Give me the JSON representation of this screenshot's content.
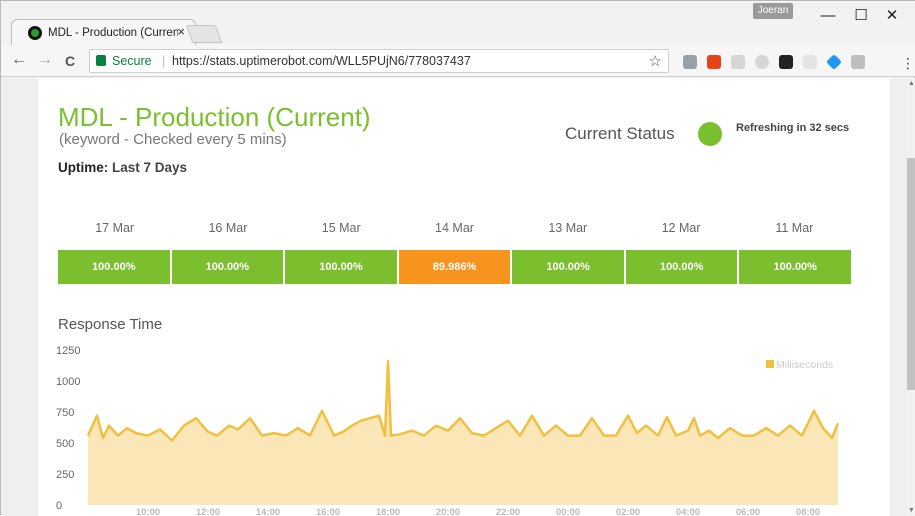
{
  "browser": {
    "tab_title": "MDL - Production (Current)",
    "tab_close": "×",
    "user_badge": "Joeran",
    "window_controls": {
      "minimize": "—",
      "maximize": "☐",
      "close": "✕"
    },
    "nav": {
      "back": "←",
      "forward": "→",
      "reload": "C"
    },
    "secure_label": "Secure",
    "url": "https://stats.uptimerobot.com/WLL5PUjN6/778037437",
    "star": "☆",
    "menu": "⋮",
    "extension_icons": [
      "download-icon",
      "office-icon",
      "cl-icon",
      "circle-icon",
      "hat-icon",
      "font-icon",
      "diamond-icon",
      "puzzle-icon"
    ]
  },
  "monitor": {
    "title": "MDL - Production (Current)",
    "subtitle": "(keyword - Checked every 5 mins)",
    "uptime_label": "Uptime",
    "uptime_range": ": Last 7 Days",
    "status_label": "Current Status",
    "status_color": "#7bbf2f",
    "refresh_text": "Refreshing in 32 secs"
  },
  "days": [
    {
      "label": "17 Mar",
      "uptime": "100.00%",
      "color": "#7bbf2f"
    },
    {
      "label": "16 Mar",
      "uptime": "100.00%",
      "color": "#7bbf2f"
    },
    {
      "label": "15 Mar",
      "uptime": "100.00%",
      "color": "#7bbf2f"
    },
    {
      "label": "14 Mar",
      "uptime": "89.986%",
      "color": "#f7941d"
    },
    {
      "label": "13 Mar",
      "uptime": "100.00%",
      "color": "#7bbf2f"
    },
    {
      "label": "12 Mar",
      "uptime": "100.00%",
      "color": "#7bbf2f"
    },
    {
      "label": "11 Mar",
      "uptime": "100.00%",
      "color": "#7bbf2f"
    }
  ],
  "response_time_title": "Response Time",
  "chart_data": {
    "type": "area",
    "title": "Response Time",
    "legend": "Milliseconds",
    "legend_position": "top-right",
    "color": "#f0c040",
    "ylim": [
      0,
      1250
    ],
    "yticks": [
      0,
      250,
      500,
      750,
      1000,
      1250
    ],
    "xticks": [
      "10:00",
      "12:00",
      "14:00",
      "16:00",
      "18:00",
      "20:00",
      "22:00",
      "00:00",
      "02:00",
      "04:00",
      "06:00",
      "08:00"
    ],
    "x_hours": [
      8.0,
      8.3,
      8.5,
      8.7,
      9.0,
      9.3,
      9.6,
      10.0,
      10.4,
      10.8,
      11.2,
      11.6,
      12.0,
      12.3,
      12.7,
      13.0,
      13.4,
      13.8,
      14.2,
      14.6,
      15.0,
      15.4,
      15.8,
      16.2,
      16.5,
      16.8,
      17.1,
      17.4,
      17.7,
      17.9,
      18.0,
      18.1,
      18.4,
      18.8,
      19.2,
      19.6,
      20.0,
      20.4,
      20.8,
      21.2,
      21.6,
      22.0,
      22.4,
      22.8,
      23.2,
      23.6,
      24.0,
      24.4,
      24.8,
      25.2,
      25.6,
      26.0,
      26.3,
      26.6,
      27.0,
      27.3,
      27.6,
      28.0,
      28.2,
      28.4,
      28.7,
      29.0,
      29.4,
      29.8,
      30.2,
      30.6,
      31.0,
      31.4,
      31.8,
      32.2,
      32.5,
      32.8,
      33.0
    ],
    "values": [
      560,
      720,
      540,
      640,
      560,
      620,
      580,
      560,
      610,
      520,
      640,
      700,
      590,
      560,
      640,
      610,
      700,
      560,
      580,
      560,
      620,
      560,
      760,
      560,
      590,
      640,
      680,
      700,
      720,
      560,
      1160,
      560,
      570,
      600,
      560,
      640,
      600,
      700,
      580,
      560,
      620,
      680,
      560,
      720,
      560,
      640,
      560,
      560,
      700,
      560,
      560,
      720,
      580,
      640,
      560,
      710,
      560,
      600,
      700,
      560,
      600,
      540,
      620,
      560,
      560,
      620,
      560,
      640,
      560,
      760,
      620,
      540,
      660
    ]
  }
}
